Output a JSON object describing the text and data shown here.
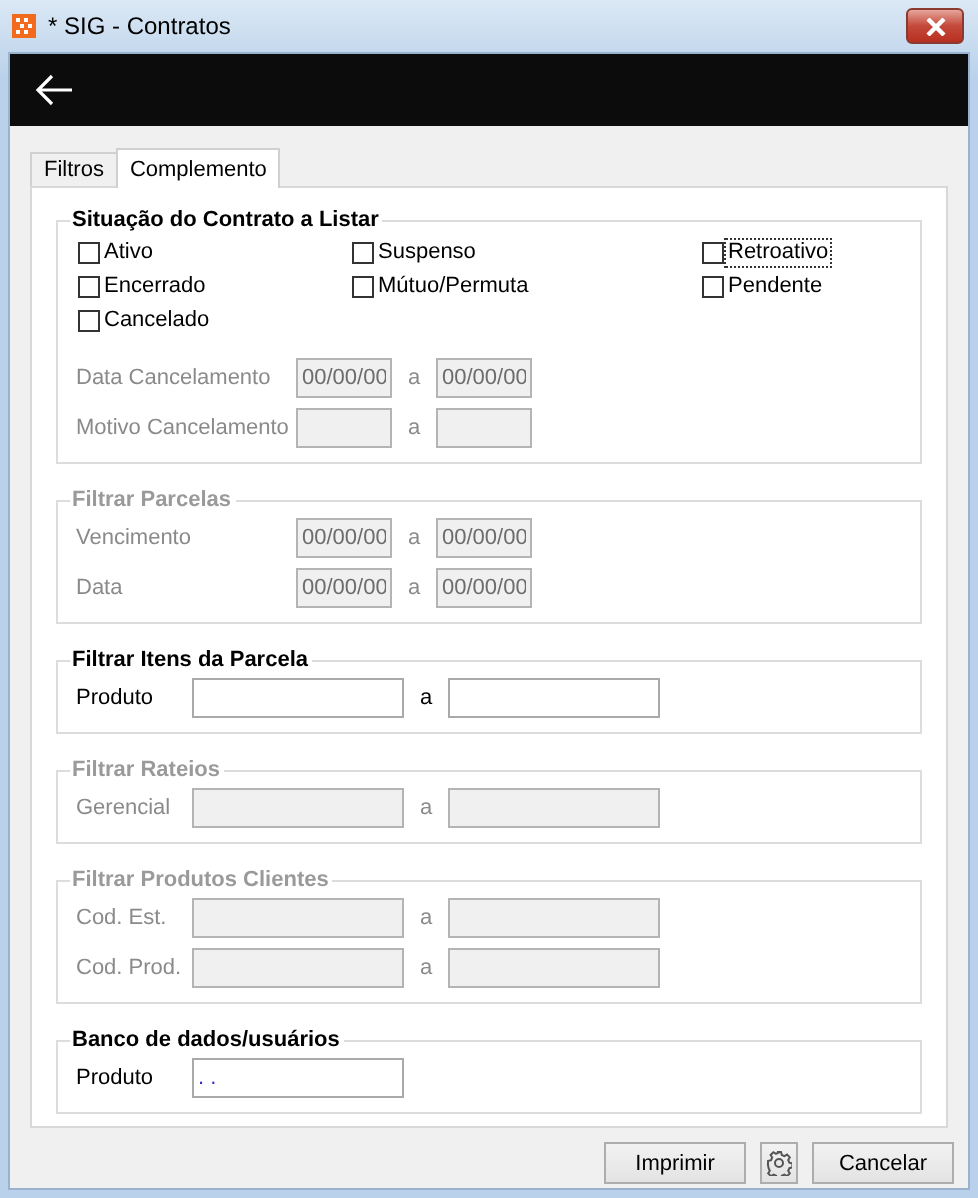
{
  "window": {
    "title": "* SIG - Contratos"
  },
  "tabs": [
    {
      "label": "Filtros",
      "selected": false
    },
    {
      "label": "Complemento",
      "selected": true
    }
  ],
  "groups": [
    {
      "title": "Situação do Contrato a Listar",
      "disabled": false,
      "checkboxes": [
        {
          "label": "Ativo",
          "checked": false,
          "focused": false
        },
        {
          "label": "Suspenso",
          "checked": false,
          "focused": false
        },
        {
          "label": "Retroativo",
          "checked": false,
          "focused": true
        },
        {
          "label": "Encerrado",
          "checked": false,
          "focused": false
        },
        {
          "label": "Mútuo/Permuta",
          "checked": false,
          "focused": false
        },
        {
          "label": "Pendente",
          "checked": false,
          "focused": false
        },
        {
          "label": "Cancelado",
          "checked": false,
          "focused": false
        }
      ],
      "rows": [
        {
          "label": "Data Cancelamento",
          "kind": "short",
          "disabled": true,
          "from": "00/00/00",
          "separator": "a",
          "to": "00/00/00"
        },
        {
          "label": "Motivo Cancelamento",
          "kind": "short",
          "disabled": true,
          "separator": "a"
        }
      ]
    },
    {
      "title": "Filtrar Parcelas",
      "disabled": true,
      "rows": [
        {
          "label": "Vencimento",
          "kind": "short",
          "disabled": true,
          "from": "00/00/00",
          "separator": "a",
          "to": "00/00/00"
        },
        {
          "label": "Data",
          "kind": "short",
          "disabled": true,
          "from": "00/00/00",
          "separator": "a",
          "to": "00/00/00"
        }
      ]
    },
    {
      "title": "Filtrar Itens da Parcela",
      "disabled": false,
      "rows": [
        {
          "label": "Produto",
          "kind": "long",
          "disabled": false,
          "separator": "a"
        }
      ]
    },
    {
      "title": "Filtrar Rateios",
      "disabled": true,
      "rows": [
        {
          "label": "Gerencial",
          "kind": "long",
          "disabled": true,
          "separator": "a"
        }
      ]
    },
    {
      "title": "Filtrar Produtos Clientes",
      "disabled": true,
      "rows": [
        {
          "label": "Cod. Est.",
          "kind": "long",
          "disabled": true,
          "separator": "a"
        },
        {
          "label": "Cod. Prod.",
          "kind": "long",
          "disabled": true,
          "separator": "a"
        }
      ]
    },
    {
      "title": "Banco de dados/usuários",
      "disabled": false,
      "rows": [
        {
          "label": "Produto",
          "kind": "long",
          "disabled": false,
          "from": ". ."
        }
      ]
    }
  ],
  "buttons": [
    {
      "kind": "text",
      "label": "Imprimir"
    },
    {
      "kind": "gear"
    },
    {
      "kind": "text",
      "label": "Cancelar"
    }
  ]
}
